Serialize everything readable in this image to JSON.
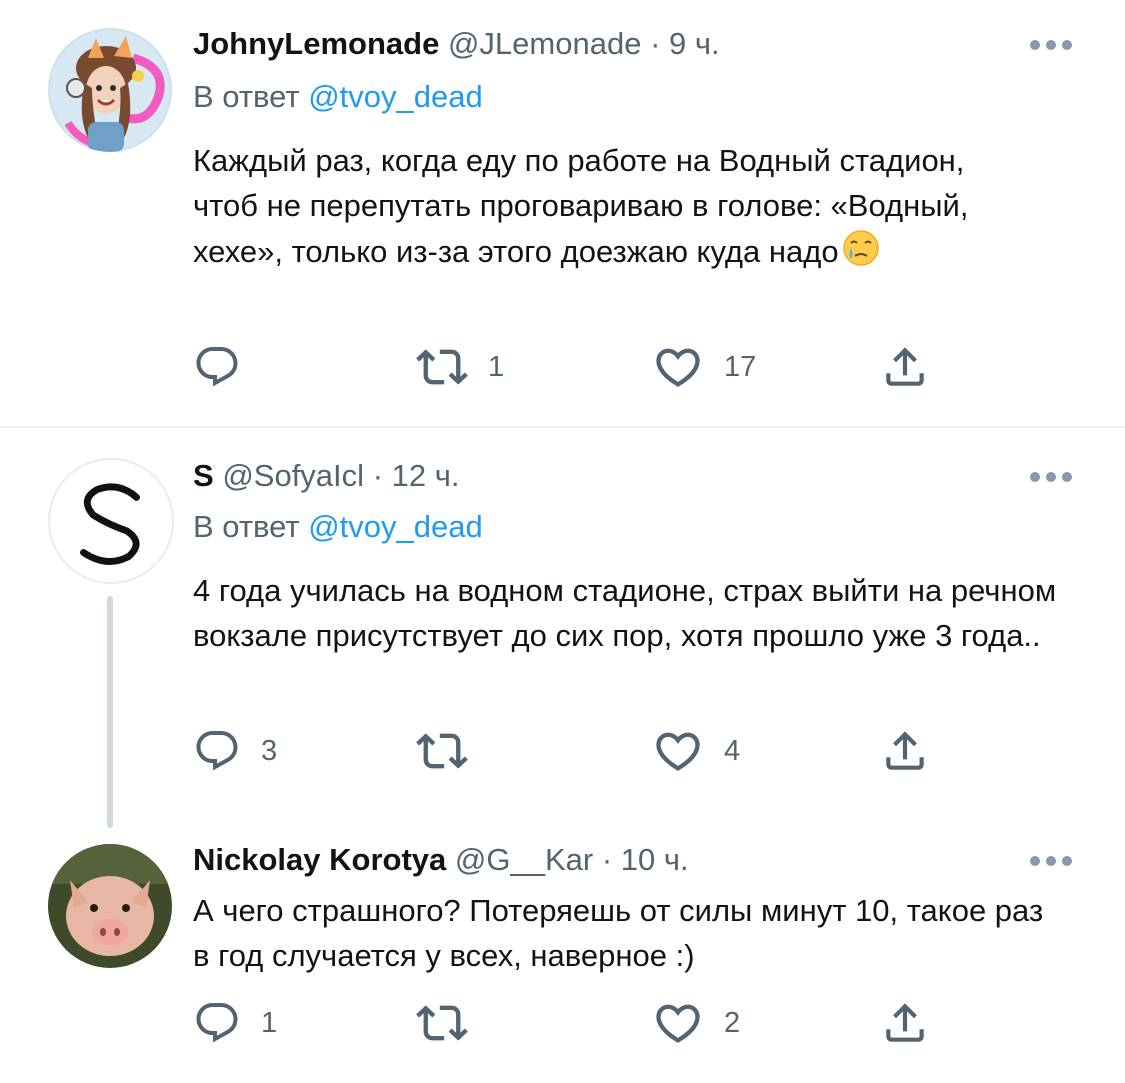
{
  "colors": {
    "text": "#0f1419",
    "secondary": "#536471",
    "link": "#1d9bf0",
    "divider": "#eff3f4",
    "thread_line": "#cfd9de"
  },
  "tweets": [
    {
      "name": "JohnyLemonade",
      "handle": "@JLemonade",
      "dot": "·",
      "time": "9 ч.",
      "reply_prefix": "В ответ",
      "reply_to": "@tvoy_dead",
      "text": "Каждый раз, когда еду по работе на Водный стадион, чтоб не перепутать проговариваю в голове: «Водный, хехе», только из-за этого доезжаю куда надо",
      "emoji": "crying-face-emoji",
      "avatar": "anime-girl-avatar",
      "replies": "",
      "retweets": "1",
      "likes": "17"
    },
    {
      "name": "S",
      "handle": "@SofyaIcl",
      "dot": "·",
      "time": "12 ч.",
      "reply_prefix": "В ответ",
      "reply_to": "@tvoy_dead",
      "text": "4 года училась на водном стадионе, страх выйти на речном вокзале присутствует до сих пор, хотя прошло уже 3 года..",
      "avatar": "letter-s-avatar",
      "replies": "3",
      "retweets": "",
      "likes": "4"
    },
    {
      "name": "Nickolay Korotya",
      "handle": "@G__Kar",
      "dot": "·",
      "time": "10 ч.",
      "text": "А чего страшного? Потеряешь от силы минут 10, такое раз в год случается у всех, наверное :)",
      "avatar": "pig-avatar",
      "replies": "1",
      "retweets": "",
      "likes": "2"
    }
  ],
  "icons": {
    "reply": "reply-bubble-icon",
    "retweet": "retweet-icon",
    "like": "heart-icon",
    "share": "share-icon",
    "more": "more-dots-icon"
  }
}
